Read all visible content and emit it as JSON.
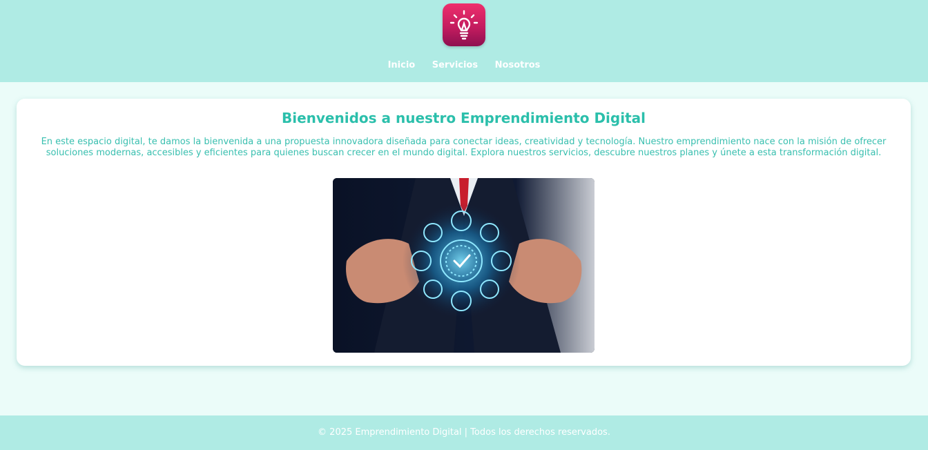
{
  "header": {
    "logo_icon": "lightbulb-icon",
    "nav": {
      "home": "Inicio",
      "services": "Servicios",
      "about": "Nosotros"
    }
  },
  "main": {
    "title": "Bienvenidos a nuestro Emprendimiento Digital",
    "description": "En este espacio digital, te damos la bienvenida a una propuesta innovadora diseñada para conectar ideas, creatividad y tecnología. Nuestro emprendimiento nace con la misión de ofrecer soluciones modernas, accesibles y eficientes para quienes buscan crecer en el mundo digital. Explora nuestros servicios, descubre nuestros planes y únete a esta transformación digital."
  },
  "footer": {
    "text": "© 2025 Emprendimiento Digital | Todos los derechos reservados."
  },
  "colors": {
    "header_bg": "#afebe4",
    "page_bg": "#ebfcf9",
    "accent": "#2bbfab",
    "logo": "#d81f63"
  }
}
